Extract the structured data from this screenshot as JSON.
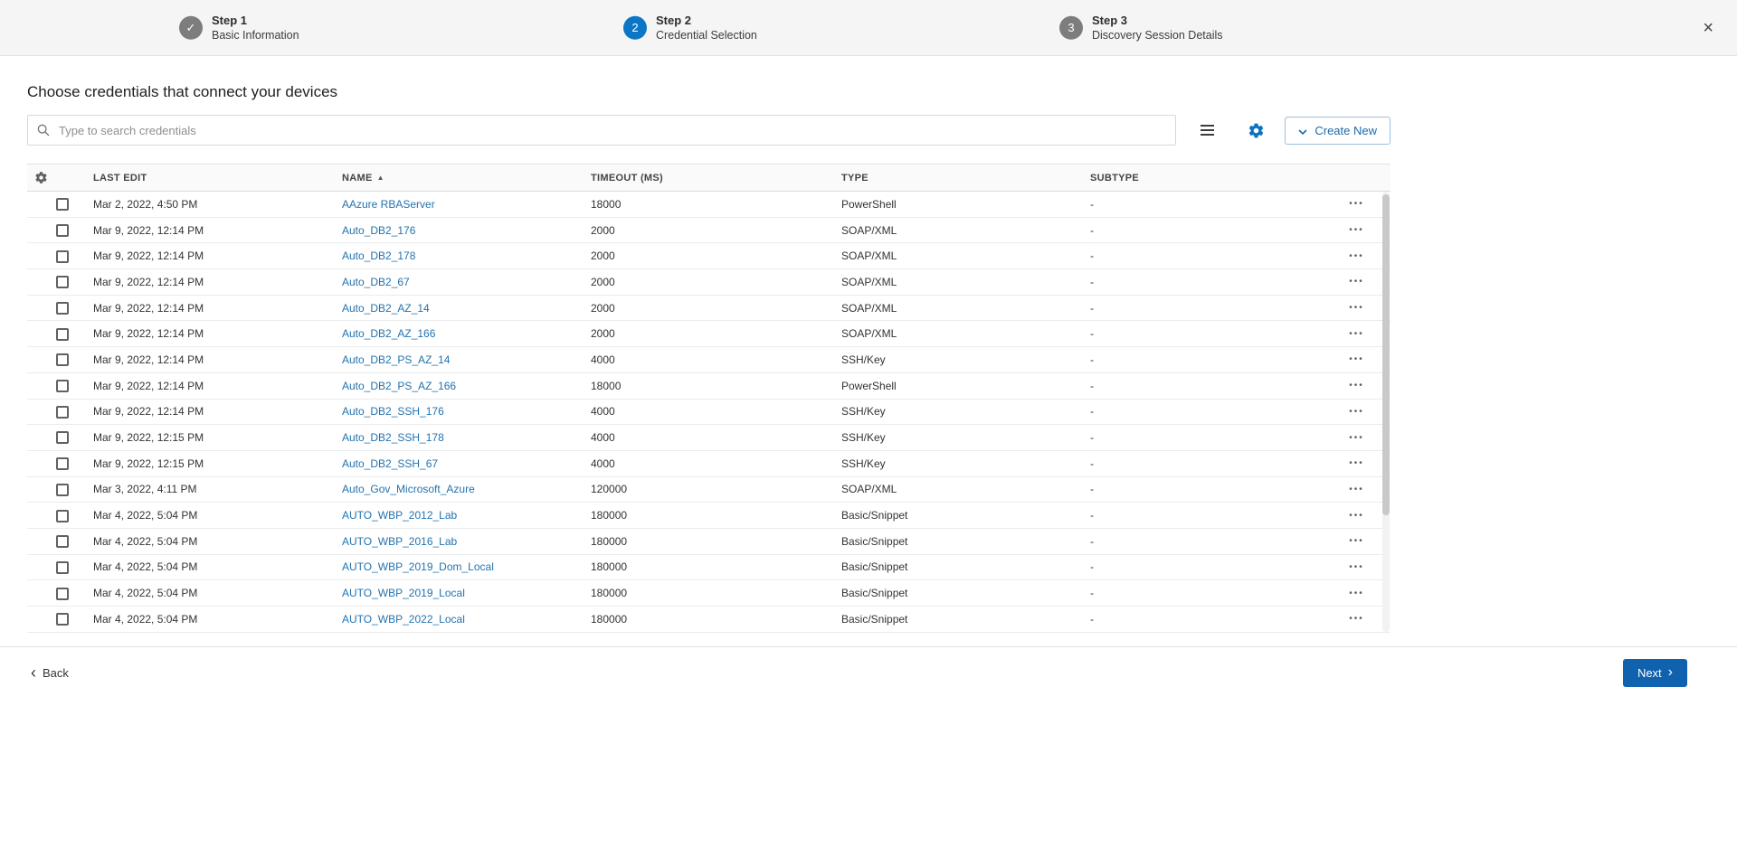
{
  "stepper": {
    "steps": [
      {
        "label": "Step 1",
        "sublabel": "Basic Information",
        "state": "completed"
      },
      {
        "label": "Step 2",
        "sublabel": "Credential Selection",
        "state": "active",
        "number": "2"
      },
      {
        "label": "Step 3",
        "sublabel": "Discovery Session Details",
        "state": "upcoming",
        "number": "3"
      }
    ]
  },
  "icons": {
    "check": "✓",
    "close": "×",
    "sort_asc": "▲",
    "back_chevron": "‹",
    "next_chevron": "›",
    "ellipsis": "•••"
  },
  "main": {
    "title": "Choose credentials that connect your devices",
    "search": {
      "placeholder": "Type to search credentials",
      "value": ""
    },
    "toolbar": {
      "create_new_label": "Create New"
    }
  },
  "table": {
    "columns": [
      "LAST EDIT",
      "NAME",
      "TIMEOUT (MS)",
      "TYPE",
      "SUBTYPE"
    ],
    "sort_column": "NAME",
    "sort_direction": "asc",
    "rows": [
      {
        "last_edit": "Mar 2, 2022, 4:50 PM",
        "name": "AAzure RBAServer",
        "timeout": "18000",
        "type": "PowerShell",
        "subtype": "-"
      },
      {
        "last_edit": "Mar 9, 2022, 12:14 PM",
        "name": "Auto_DB2_176",
        "timeout": "2000",
        "type": "SOAP/XML",
        "subtype": "-"
      },
      {
        "last_edit": "Mar 9, 2022, 12:14 PM",
        "name": "Auto_DB2_178",
        "timeout": "2000",
        "type": "SOAP/XML",
        "subtype": "-"
      },
      {
        "last_edit": "Mar 9, 2022, 12:14 PM",
        "name": "Auto_DB2_67",
        "timeout": "2000",
        "type": "SOAP/XML",
        "subtype": "-"
      },
      {
        "last_edit": "Mar 9, 2022, 12:14 PM",
        "name": "Auto_DB2_AZ_14",
        "timeout": "2000",
        "type": "SOAP/XML",
        "subtype": "-"
      },
      {
        "last_edit": "Mar 9, 2022, 12:14 PM",
        "name": "Auto_DB2_AZ_166",
        "timeout": "2000",
        "type": "SOAP/XML",
        "subtype": "-"
      },
      {
        "last_edit": "Mar 9, 2022, 12:14 PM",
        "name": "Auto_DB2_PS_AZ_14",
        "timeout": "4000",
        "type": "SSH/Key",
        "subtype": "-"
      },
      {
        "last_edit": "Mar 9, 2022, 12:14 PM",
        "name": "Auto_DB2_PS_AZ_166",
        "timeout": "18000",
        "type": "PowerShell",
        "subtype": "-"
      },
      {
        "last_edit": "Mar 9, 2022, 12:14 PM",
        "name": "Auto_DB2_SSH_176",
        "timeout": "4000",
        "type": "SSH/Key",
        "subtype": "-"
      },
      {
        "last_edit": "Mar 9, 2022, 12:15 PM",
        "name": "Auto_DB2_SSH_178",
        "timeout": "4000",
        "type": "SSH/Key",
        "subtype": "-"
      },
      {
        "last_edit": "Mar 9, 2022, 12:15 PM",
        "name": "Auto_DB2_SSH_67",
        "timeout": "4000",
        "type": "SSH/Key",
        "subtype": "-"
      },
      {
        "last_edit": "Mar 3, 2022, 4:11 PM",
        "name": "Auto_Gov_Microsoft_Azure",
        "timeout": "120000",
        "type": "SOAP/XML",
        "subtype": "-"
      },
      {
        "last_edit": "Mar 4, 2022, 5:04 PM",
        "name": "AUTO_WBP_2012_Lab",
        "timeout": "180000",
        "type": "Basic/Snippet",
        "subtype": "-"
      },
      {
        "last_edit": "Mar 4, 2022, 5:04 PM",
        "name": "AUTO_WBP_2016_Lab",
        "timeout": "180000",
        "type": "Basic/Snippet",
        "subtype": "-"
      },
      {
        "last_edit": "Mar 4, 2022, 5:04 PM",
        "name": "AUTO_WBP_2019_Dom_Local",
        "timeout": "180000",
        "type": "Basic/Snippet",
        "subtype": "-"
      },
      {
        "last_edit": "Mar 4, 2022, 5:04 PM",
        "name": "AUTO_WBP_2019_Local",
        "timeout": "180000",
        "type": "Basic/Snippet",
        "subtype": "-"
      },
      {
        "last_edit": "Mar 4, 2022, 5:04 PM",
        "name": "AUTO_WBP_2022_Local",
        "timeout": "180000",
        "type": "Basic/Snippet",
        "subtype": "-"
      }
    ]
  },
  "footer": {
    "back_label": "Back",
    "next_label": "Next"
  },
  "colors": {
    "accent_blue": "#0b76c5",
    "link_blue": "#2373af",
    "primary_button_blue": "#1061ae",
    "header_bg": "#f5f5f5"
  }
}
